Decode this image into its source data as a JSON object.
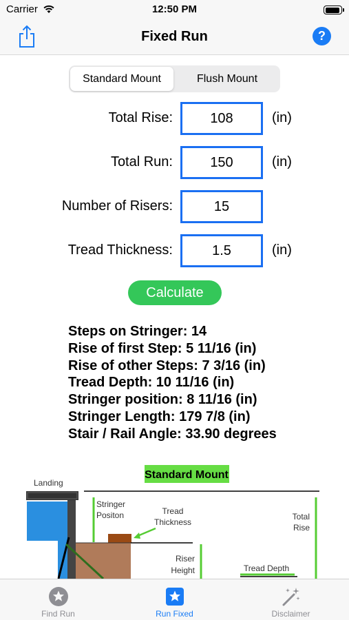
{
  "status": {
    "carrier": "Carrier",
    "time": "12:50 PM",
    "battery_level": 0.85
  },
  "nav": {
    "title": "Fixed Run",
    "help_label": "?"
  },
  "segments": [
    {
      "label": "Standard Mount",
      "selected": true
    },
    {
      "label": "Flush Mount",
      "selected": false
    }
  ],
  "form": {
    "rows": [
      {
        "label": "Total Rise:",
        "value": "108",
        "unit": "(in)"
      },
      {
        "label": "Total Run:",
        "value": "150",
        "unit": "(in)"
      },
      {
        "label": "Number of Risers:",
        "value": "15",
        "unit": ""
      },
      {
        "label": "Tread Thickness:",
        "value": "1.5",
        "unit": "(in)"
      }
    ]
  },
  "calculate_label": "Calculate",
  "results": [
    "Steps on Stringer: 14",
    "Rise of first Step: 5 11/16 (in)",
    "Rise of other Steps: 7 3/16 (in)",
    "Tread Depth: 10 11/16 (in)",
    "Stringer position: 8 11/16 (in)",
    "Stringer Length: 179 7/8 (in)",
    "Stair / Rail Angle: 33.90 degrees"
  ],
  "diagram": {
    "title": "Standard Mount",
    "labels": {
      "landing": "Landing",
      "stringer_1": "Stringer",
      "stringer_2": "Positon",
      "tread_1": "Tread",
      "tread_2": "Thickness",
      "total_1": "Total",
      "total_2": "Rise",
      "riser_1": "Riser",
      "riser_2": "Height",
      "tread_depth": "Tread Depth"
    },
    "colors": {
      "guide": "#55cc33",
      "title_bg": "#66dd44",
      "landing_blue": "#2a8fe0",
      "wood": "#b07b5a",
      "tread": "#9a4a14"
    }
  },
  "tabs": [
    {
      "label": "Find Run",
      "icon": "star-circle-icon",
      "active": false
    },
    {
      "label": "Run Fixed",
      "icon": "star-square-icon",
      "active": true
    },
    {
      "label": "Disclaimer",
      "icon": "magic-wand-icon",
      "active": false
    }
  ]
}
